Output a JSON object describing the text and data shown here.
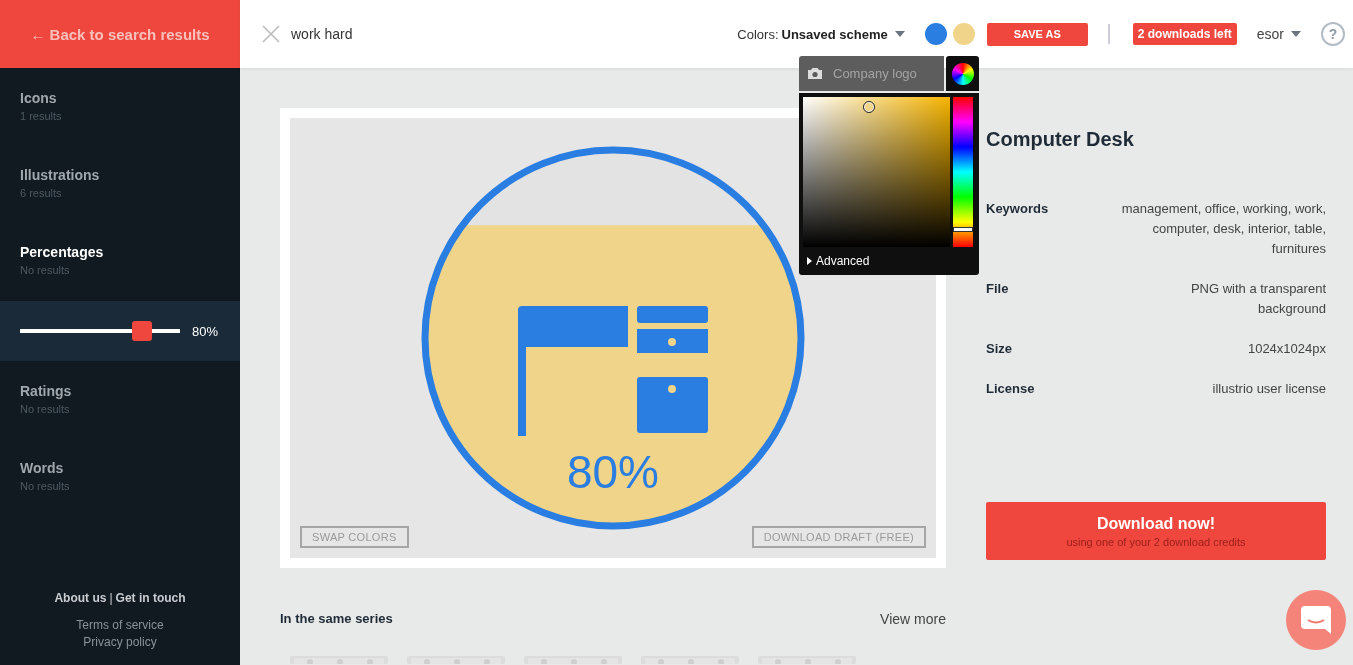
{
  "back_link": "← Back to search results",
  "search": {
    "value": "work hard"
  },
  "colors": {
    "label": "Colors:",
    "scheme": "Unsaved scheme",
    "swatches": [
      {
        "color": "#2a7de1"
      },
      {
        "color": "#f0d48a"
      }
    ]
  },
  "save_button": "SAVE AS",
  "downloads_badge": "2 downloads left",
  "user": "esor",
  "help": "?",
  "sidebar": {
    "items": [
      {
        "title": "Icons",
        "subtitle": "1 results",
        "selected": false
      },
      {
        "title": "Illustrations",
        "subtitle": "6 results",
        "selected": false
      },
      {
        "title": "Percentages",
        "subtitle": "No results",
        "selected": true,
        "slider": {
          "level": 0.8,
          "reading": "80%"
        }
      },
      {
        "title": "Ratings",
        "subtitle": "No results",
        "selected": false
      },
      {
        "title": "Words",
        "subtitle": "No results",
        "selected": false
      }
    ],
    "footer_links": [
      "About us",
      "Get in touch"
    ],
    "separator": "|",
    "legal_links": [
      "Terms of service",
      "Privacy policy"
    ]
  },
  "preview": {
    "label": "80%",
    "swap_button": "SWAP COLORS",
    "draft_button": "DOWNLOAD DRAFT (FREE)"
  },
  "color_picker": {
    "logo_placeholder": "Company logo",
    "advanced": "Advanced",
    "hue": {
      "level": 0.11
    }
  },
  "details": {
    "title": "Computer Desk",
    "rows": [
      {
        "label": "Keywords",
        "value": "management, office, working, work, computer, desk, interior, table, furnitures"
      },
      {
        "label": "File",
        "value": "PNG with a transparent background"
      },
      {
        "label": "Size",
        "value": "1024x1024px"
      },
      {
        "label": "License",
        "value": "illustrio user license"
      }
    ],
    "download": {
      "title": "Download now!",
      "subtitle": "using one of your 2 download credits"
    }
  },
  "series": {
    "title": "In the same series",
    "more": "View more"
  }
}
